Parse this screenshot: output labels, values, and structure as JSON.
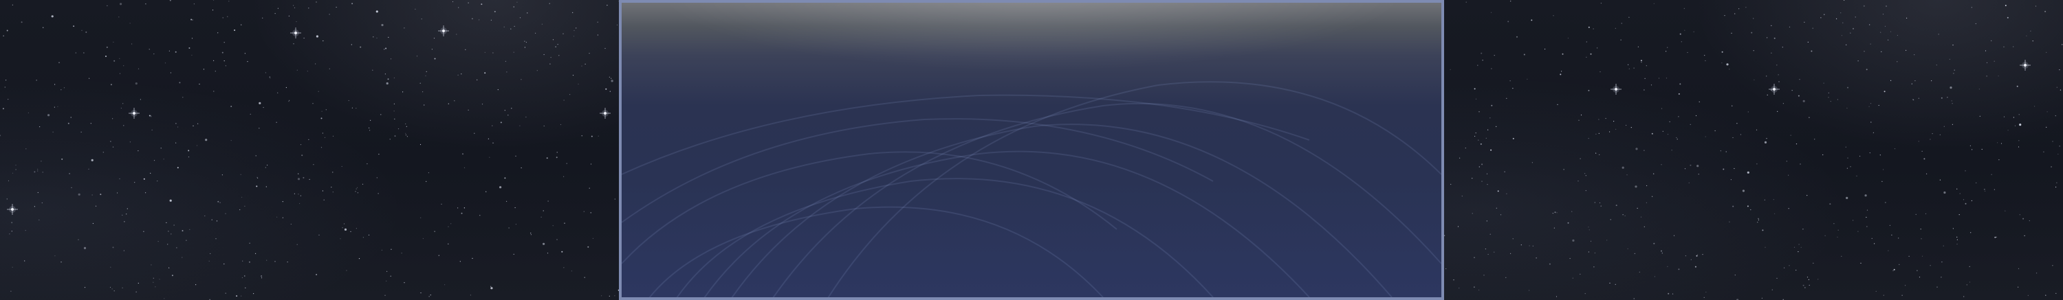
{
  "scene": {
    "background": "starfield",
    "colors": {
      "space": "#161922",
      "panel_border": "#7e8bb2",
      "panel_fill": "#2b3352",
      "panel_top_glow": "#707277"
    }
  },
  "panel": {
    "content": "",
    "decoration": "orbit-lines"
  }
}
